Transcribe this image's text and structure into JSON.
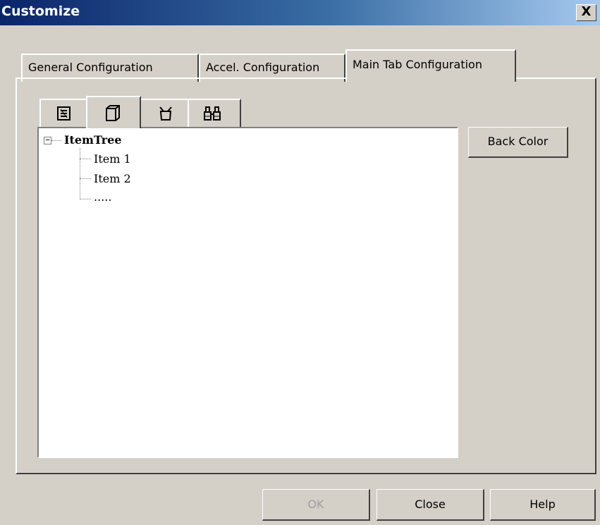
{
  "window": {
    "title": "Customize",
    "close_glyph": "X"
  },
  "tabs": [
    {
      "label": "General Configuration",
      "active": false
    },
    {
      "label": "Accel. Configuration",
      "active": false
    },
    {
      "label": "Main Tab Configuration",
      "active": true
    }
  ],
  "inner_tabs": [
    {
      "icon": "document-list-icon",
      "active": false
    },
    {
      "icon": "page-icon",
      "active": true
    },
    {
      "icon": "cup-icon",
      "active": false
    },
    {
      "icon": "binoculars-icon",
      "active": false
    }
  ],
  "tree": {
    "root": "ItemTree",
    "expander": "−",
    "children": [
      "Item 1",
      "Item 2",
      "....."
    ]
  },
  "buttons": {
    "back_color": "Back Color",
    "ok": "OK",
    "close": "Close",
    "help": "Help"
  },
  "colors": {
    "titlebar_start": "#0a246a",
    "titlebar_end": "#a6caf0",
    "face": "#d4d0c8"
  }
}
